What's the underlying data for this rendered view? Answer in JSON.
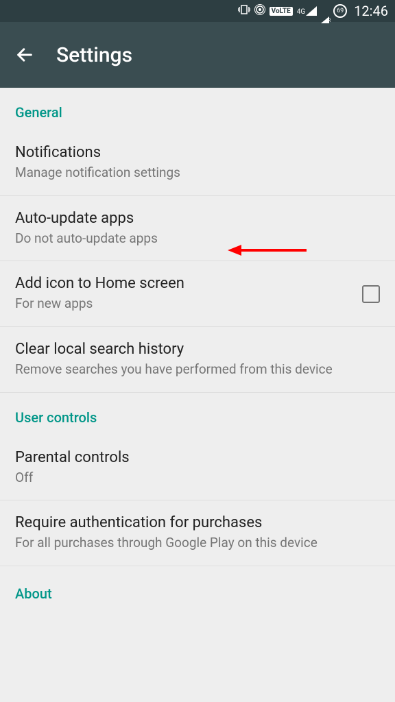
{
  "status_bar": {
    "volte": "VoLTE",
    "fourg": "4G",
    "battery": "69",
    "time": "12:46"
  },
  "app_bar": {
    "title": "Settings"
  },
  "sections": {
    "general": {
      "header": "General",
      "notifications": {
        "title": "Notifications",
        "subtitle": "Manage notification settings"
      },
      "auto_update": {
        "title": "Auto-update apps",
        "subtitle": "Do not auto-update apps"
      },
      "add_icon": {
        "title": "Add icon to Home screen",
        "subtitle": "For new apps"
      },
      "clear_history": {
        "title": "Clear local search history",
        "subtitle": "Remove searches you have performed from this device"
      }
    },
    "user_controls": {
      "header": "User controls",
      "parental": {
        "title": "Parental controls",
        "subtitle": "Off"
      },
      "auth": {
        "title": "Require authentication for purchases",
        "subtitle": "For all purchases through Google Play on this device"
      }
    },
    "about": {
      "header": "About"
    }
  }
}
